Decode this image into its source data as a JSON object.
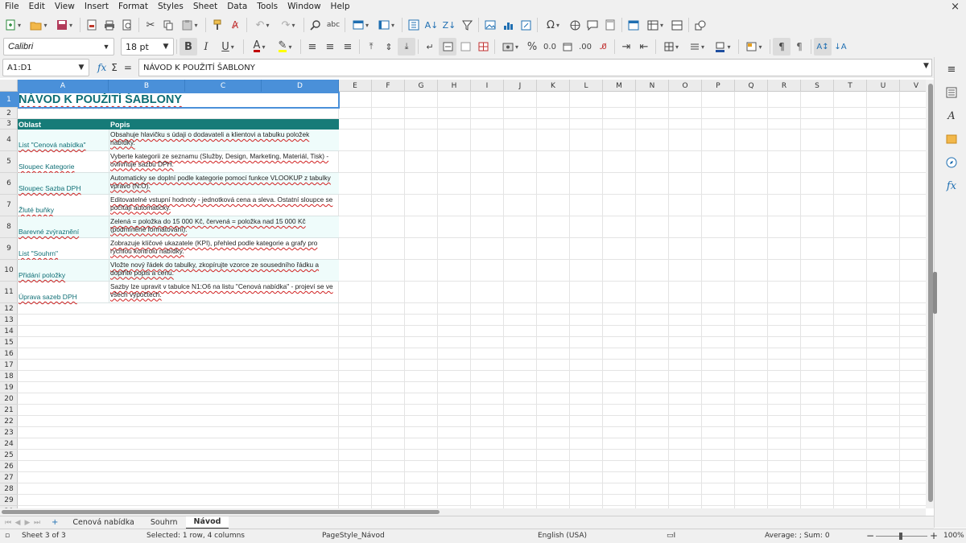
{
  "menu": [
    "File",
    "Edit",
    "View",
    "Insert",
    "Format",
    "Styles",
    "Sheet",
    "Data",
    "Tools",
    "Window",
    "Help"
  ],
  "close_symbol": "×",
  "font": {
    "name": "Calibri",
    "size": "18 pt"
  },
  "formula_bar": {
    "name_box": "A1:D1",
    "fx": "fx",
    "sum": "Σ",
    "equals": "=",
    "content": "NÁVOD K POUŽITÍ ŠABLONY"
  },
  "columns": [
    "A",
    "B",
    "C",
    "D",
    "E",
    "F",
    "G",
    "H",
    "I",
    "J",
    "K",
    "L",
    "M",
    "N",
    "O",
    "P",
    "Q",
    "R",
    "S",
    "T",
    "U",
    "V"
  ],
  "rows": [
    "1",
    "2",
    "3",
    "4",
    "5",
    "6",
    "7",
    "8",
    "9",
    "10",
    "11",
    "12",
    "13",
    "14",
    "15",
    "16",
    "17",
    "18",
    "19",
    "20",
    "21",
    "22",
    "23",
    "24",
    "25",
    "26",
    "27",
    "28",
    "29",
    "30"
  ],
  "sheet": {
    "title": "NÁVOD K POUŽITÍ ŠABLONY",
    "header": {
      "area": "Oblast",
      "description": "Popis"
    },
    "rows": [
      {
        "area": "List \"Cenová nabídka\"",
        "description": "Obsahuje hlavičku s údaji o dodavateli a klientovi a tabulku položek nabídky."
      },
      {
        "area": "Sloupec Kategorie",
        "description": "Vyberte kategorii ze seznamu (Služby, Design, Marketing, Materiál, Tisk) - ovlivňuje sazbu DPH."
      },
      {
        "area": "Sloupec Sazba DPH",
        "description": "Automaticky se doplní podle kategorie pomocí funkce VLOOKUP z tabulky vpravo (N:O)."
      },
      {
        "area": "Žluté buňky",
        "description": "Editovatelné vstupní hodnoty - jednotková cena a sleva. Ostatní sloupce se počítají automaticky."
      },
      {
        "area": "Barevné zvýraznění",
        "description": "Zelená = položka do 15 000 Kč, červená = položka nad 15 000 Kč (podmíněné formátování)."
      },
      {
        "area": "List \"Souhrn\"",
        "description": "Zobrazuje klíčové ukazatele (KPI), přehled podle kategorie a grafy pro rychlou kontrolu nabídky."
      },
      {
        "area": "Přidání položky",
        "description": "Vložte nový řádek do tabulky, zkopírujte vzorce ze sousedního řádku a doplňte popis a cenu."
      },
      {
        "area": "Úprava sazeb DPH",
        "description": "Sazby lze upravit v tabulce N1:O6 na listu \"Cenová nabídka\" - projeví se ve všech výpočtech."
      }
    ]
  },
  "tabs": {
    "add": "+",
    "items": [
      "Cenová nabídka",
      "Souhrn",
      "Návod"
    ],
    "active": "Návod"
  },
  "status": {
    "sheet": "Sheet 3 of 3",
    "selection": "Selected: 1 row, 4 columns",
    "page_style": "PageStyle_Návod",
    "language": "English (USA)",
    "summary": "Average: ; Sum: 0",
    "zoom_minus": "−",
    "zoom_plus": "+",
    "zoom": "100%"
  },
  "colors": {
    "accent": "#167b78",
    "title": "#0e6e75",
    "selection": "#4a90d9",
    "alt_row": "#effcfb"
  }
}
